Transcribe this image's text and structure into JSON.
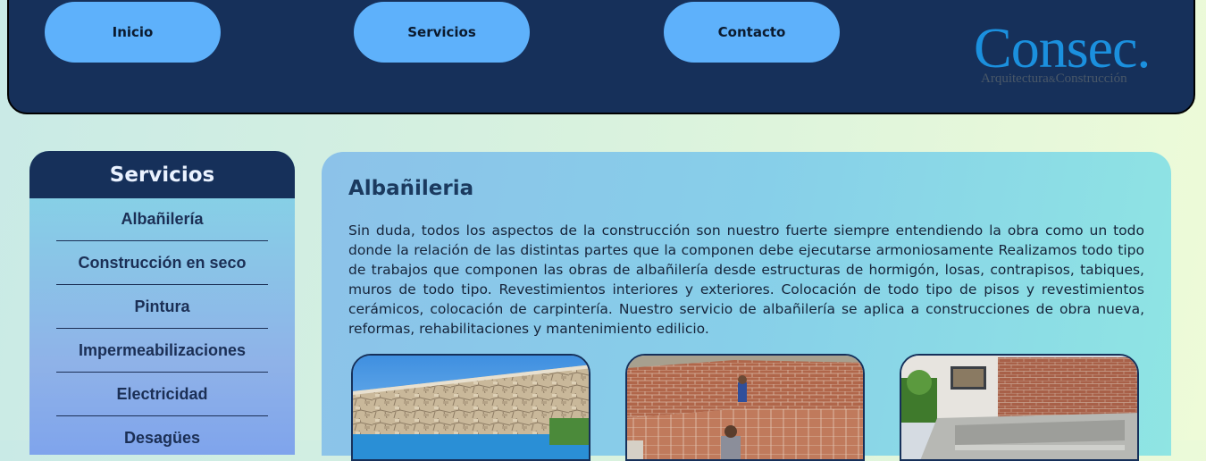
{
  "nav": {
    "items": [
      "Inicio",
      "Servicios",
      "Contacto"
    ]
  },
  "logo": {
    "main": "Consec.",
    "sub_left": "Arquitectura",
    "sub_amp": "&",
    "sub_right": "Construcción"
  },
  "sidebar": {
    "title": "Servicios",
    "items": [
      "Albañilería",
      "Construcción en seco",
      "Pintura",
      "Impermeabilizaciones",
      "Electricidad",
      "Desagües"
    ]
  },
  "main": {
    "title": "Albañileria",
    "text": "Sin duda, todos los aspectos de la construcción son nuestro fuerte siempre entendiendo la obra como un todo donde la relación de las distintas partes que la componen debe ejecutarse armoniosamente Realizamos todo tipo de trabajos que componen las obras de albañilería desde estructuras de hormigón, losas, contrapisos, tabiques, muros de todo tipo. Revestimientos interiores y exteriores. Colocación de todo tipo de pisos y revestimientos cerámicos, colocación de carpintería. Nuestro servicio de albañilería se aplica a construcciones de obra nueva, reformas, rehabilitaciones y mantenimiento edilicio."
  },
  "colors": {
    "header_bg": "#16305a",
    "nav_button": "#5eb1fb",
    "logo_blue": "#1b90de"
  }
}
